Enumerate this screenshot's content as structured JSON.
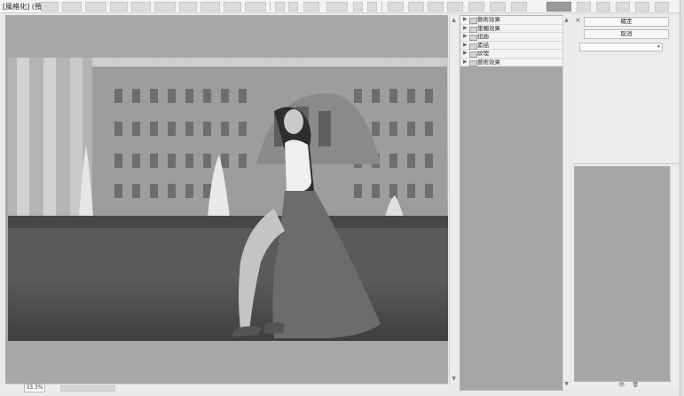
{
  "window": {
    "title": "[風格化] (預設值)"
  },
  "canvas": {
    "zoom": "33.3%",
    "background_color": "#a8a8a8"
  },
  "tree": {
    "items": [
      {
        "label": "藝術效果"
      },
      {
        "label": "筆觸效果"
      },
      {
        "label": "扭曲"
      },
      {
        "label": "素描"
      },
      {
        "label": "紋理"
      },
      {
        "label": "藝術效果"
      }
    ]
  },
  "right_panel": {
    "close": "×",
    "ok_label": "確定",
    "cancel_label": "取消",
    "select_value": "",
    "footer_icons": [
      "👁",
      "🗑"
    ]
  },
  "colors": {
    "ui_bg": "#e9e9e9",
    "canvas_bg": "#a8a8a8",
    "panel_bg": "#a5a5a5"
  }
}
